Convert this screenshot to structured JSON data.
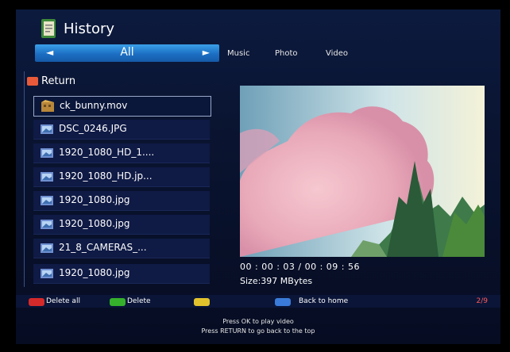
{
  "header": {
    "title": "History"
  },
  "category_bar": {
    "current": "All",
    "left_arrow": "◄",
    "right_arrow": "►"
  },
  "tabs": [
    "Music",
    "Photo",
    "Video"
  ],
  "file_list": {
    "return_label": "Return",
    "items": [
      {
        "name": "ck_bunny.mov",
        "type": "video",
        "selected": true
      },
      {
        "name": "DSC_0246.JPG",
        "type": "image",
        "selected": false
      },
      {
        "name": "1920_1080_HD_1....",
        "type": "image",
        "selected": false
      },
      {
        "name": "1920_1080_HD.jp...",
        "type": "image",
        "selected": false
      },
      {
        "name": "1920_1080.jpg",
        "type": "image",
        "selected": false
      },
      {
        "name": "1920_1080.jpg",
        "type": "image",
        "selected": false
      },
      {
        "name": "21_8_CAMERAS_...",
        "type": "image",
        "selected": false
      },
      {
        "name": "1920_1080.jpg",
        "type": "image",
        "selected": false
      }
    ]
  },
  "preview": {
    "time": "00 : 00 : 03 / 00 : 09 : 56",
    "size": "Size:397 MBytes"
  },
  "bottom_bar": {
    "delete_all": "Delete all",
    "delete": "Delete",
    "back_home": "Back to home",
    "page": "2/9",
    "colors": {
      "red": "#d42a2a",
      "green": "#36b02c",
      "yellow": "#e2c22c",
      "blue": "#3a7ad8"
    }
  },
  "hints": {
    "line1": "Press OK to play video",
    "line2": "Press RETURN to go back to the top"
  }
}
